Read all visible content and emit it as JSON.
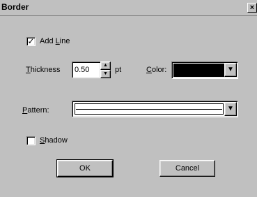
{
  "window": {
    "title": "Border",
    "close_glyph": "×"
  },
  "add_line": {
    "label_prefix": "Add ",
    "label_accel": "L",
    "label_suffix": "ine",
    "checked": true,
    "check_glyph": "✓"
  },
  "thickness": {
    "label_accel": "T",
    "label_rest": "hickness",
    "value": "0.50",
    "unit": "pt",
    "spin_up_glyph": "▲",
    "spin_down_glyph": "▼"
  },
  "color": {
    "label_accel": "C",
    "label_rest": "olor:",
    "swatch": "#000000",
    "dropdown_glyph": "▼"
  },
  "pattern": {
    "label_accel": "P",
    "label_rest": "attern:",
    "dropdown_glyph": "▼"
  },
  "shadow": {
    "label_accel": "S",
    "label_rest": "hadow",
    "checked": false
  },
  "buttons": {
    "ok": "OK",
    "cancel": "Cancel"
  }
}
